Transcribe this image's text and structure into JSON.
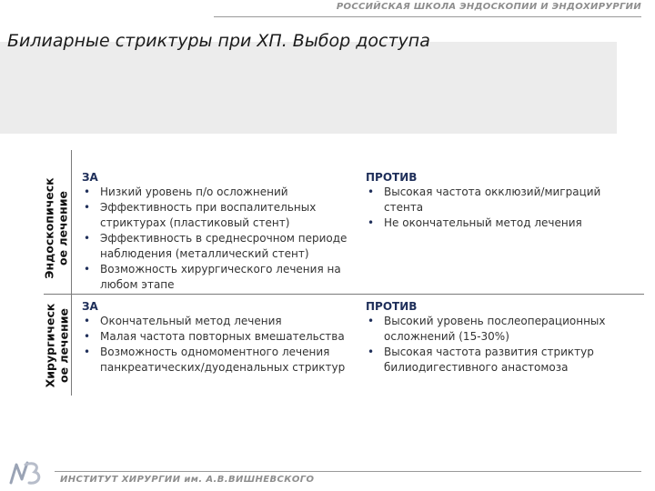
{
  "header": {
    "school": "РОССИЙСКАЯ ШКОЛА ЭНДОСКОПИИ И ЭНДОХИРУРГИИ"
  },
  "slide": {
    "title": "Билиарные стриктуры при ХП. Выбор доступа"
  },
  "rows": [
    {
      "label": "Эндоскопическ ое лечение",
      "pros_title": "ЗА",
      "pros": [
        "Низкий уровень п/о осложнений",
        "Эффективность при воспалительных стриктурах (пластиковый стент)",
        "Эффективность в среднесрочном периоде наблюдения (металлический стент)",
        "Возможность хирургического лечения на любом этапе"
      ],
      "cons_title": "ПРОТИВ",
      "cons": [
        "Высокая частота окклюзий/миграций стента",
        "Не окончательный метод лечения"
      ]
    },
    {
      "label": "Хирургическ ое лечение",
      "pros_title": "ЗА",
      "pros": [
        "Окончательный метод лечения",
        "Малая частота повторных вмешательства",
        "Возможность одномоментного лечения панкреатических/дуоденальных стриктур"
      ],
      "cons_title": "ПРОТИВ",
      "cons": [
        "Высокий уровень послеоперационных осложнений (15-30%)",
        "Высокая частота развития стриктур билиодигестивного анастомоза"
      ]
    }
  ],
  "footer": {
    "institute": "ИНСТИТУТ ХИРУРГИИ им. А.В.ВИШНЕВСКОГО"
  },
  "colors": {
    "heading": "#1f2f5a",
    "panel": "#ececec",
    "rule": "#7a7a7a"
  }
}
